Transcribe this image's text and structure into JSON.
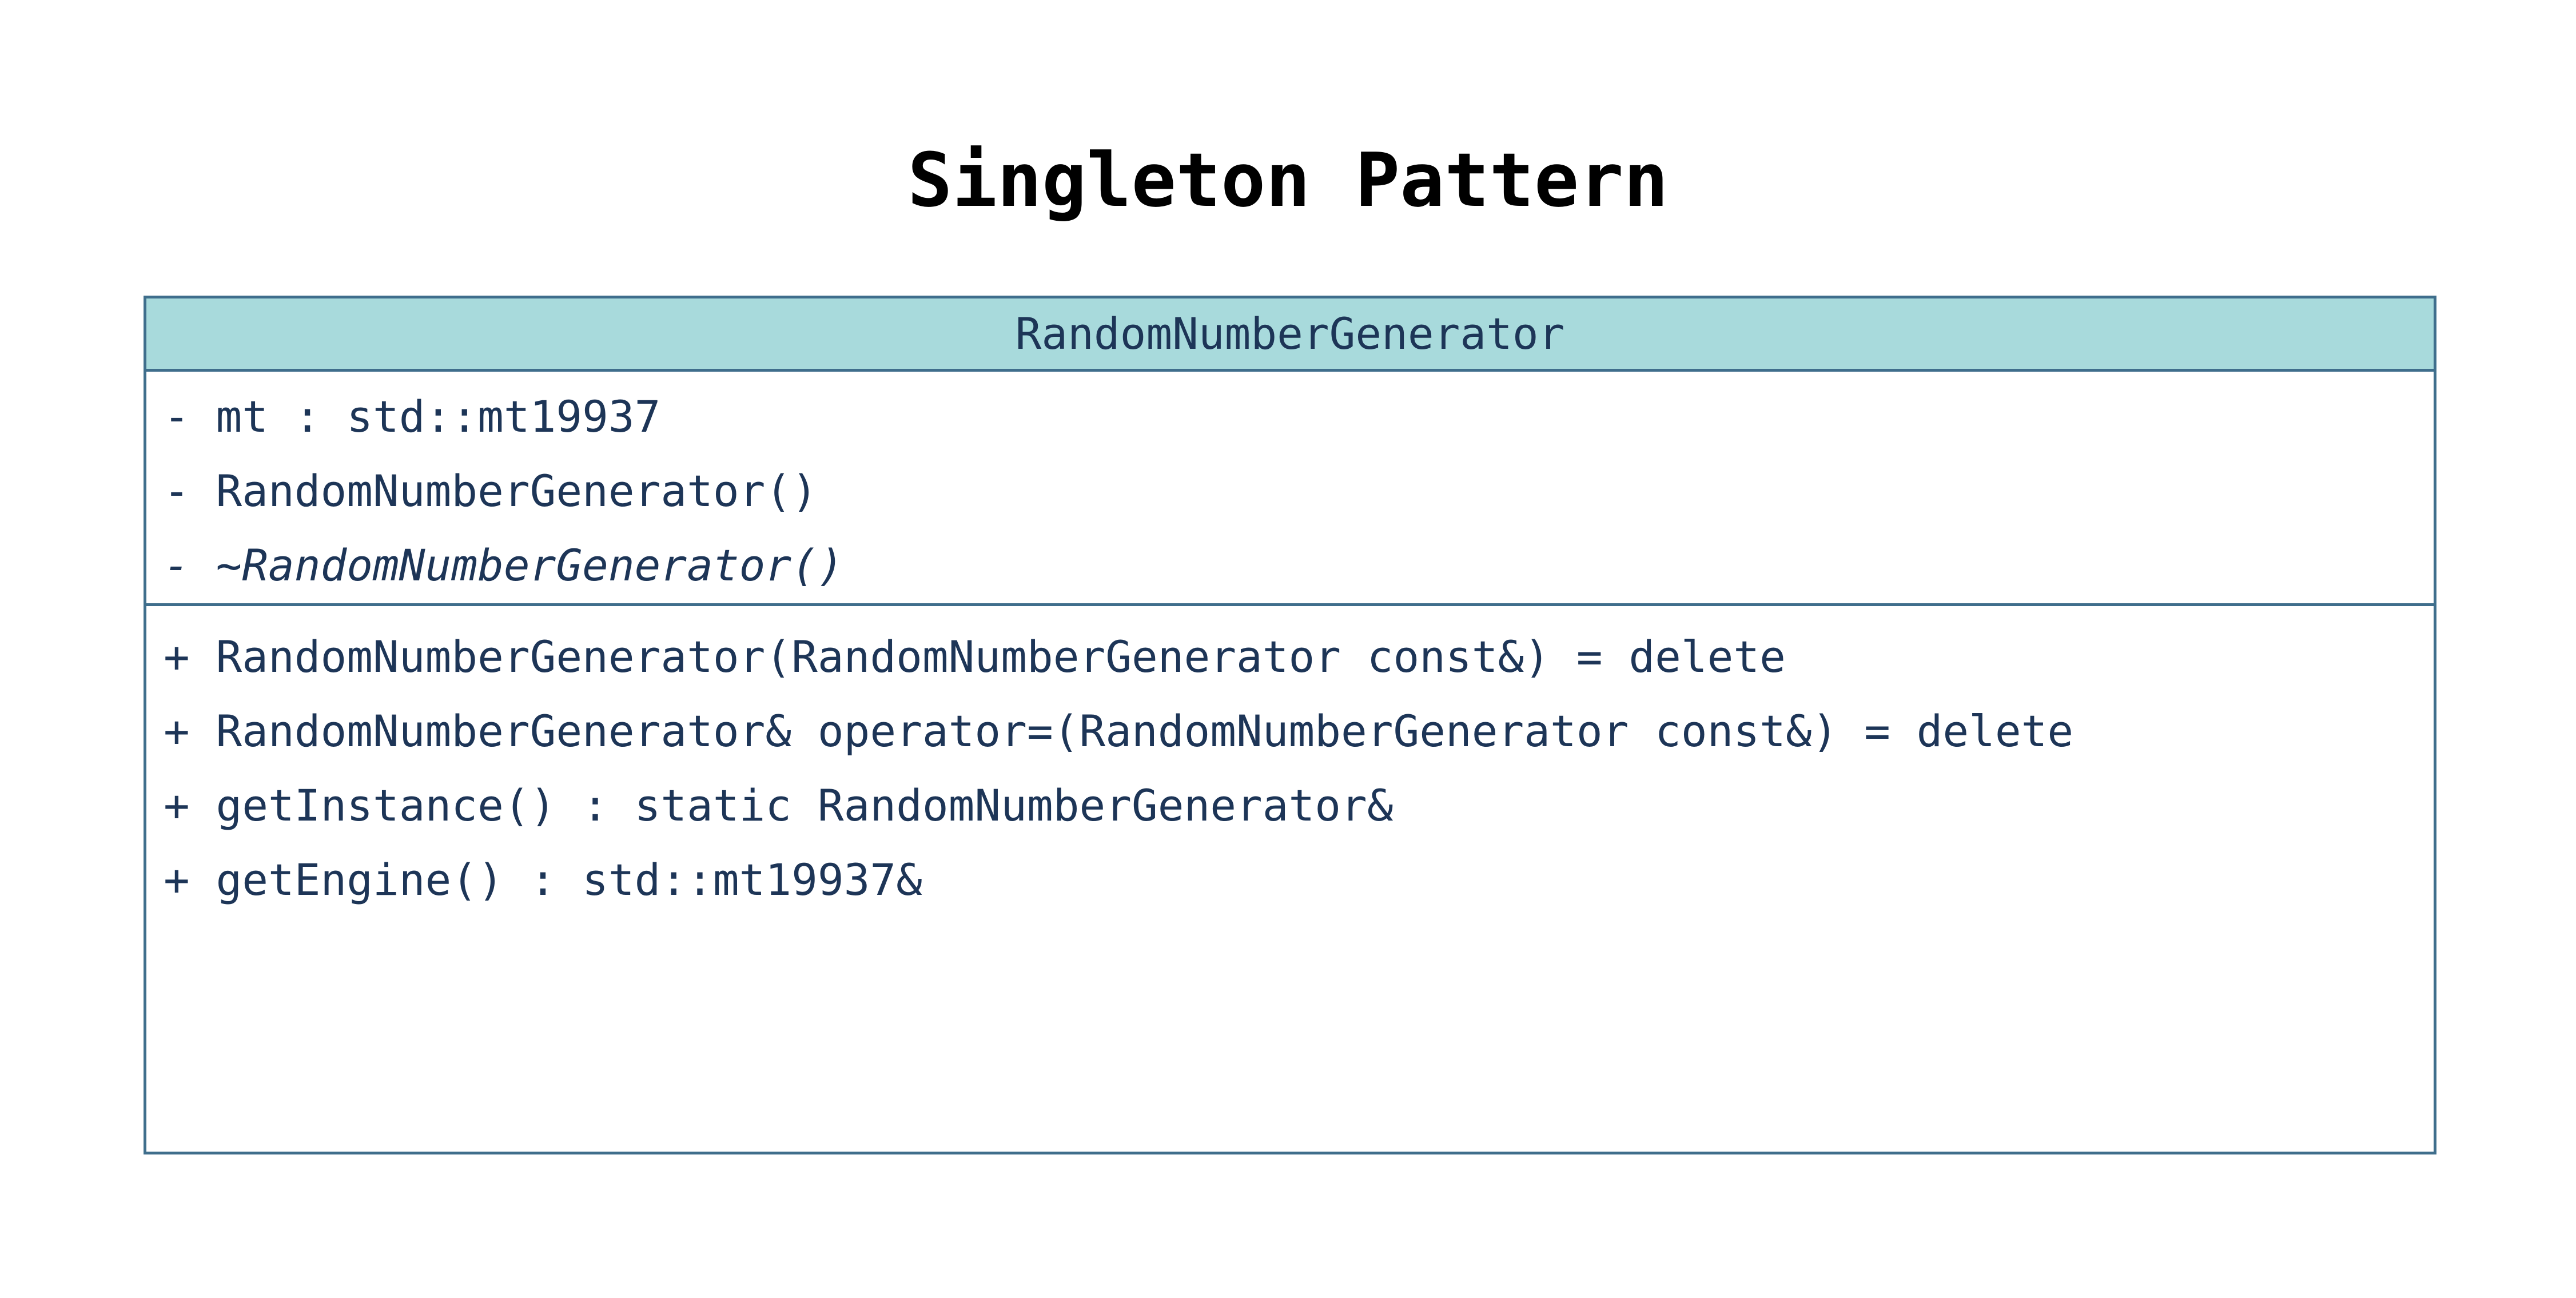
{
  "title": "Singleton Pattern",
  "class": {
    "name": "RandomNumberGenerator",
    "header_color": "#a8dadc",
    "border_color": "#3f6e8c",
    "text_color": "#1d3557",
    "attributes": [
      {
        "text": "- mt : std::mt19937",
        "italic": false
      },
      {
        "text": "- RandomNumberGenerator()",
        "italic": false
      },
      {
        "text": "- ~RandomNumberGenerator()",
        "italic": true
      }
    ],
    "operations": [
      {
        "text": "+ RandomNumberGenerator(RandomNumberGenerator const&) = delete",
        "italic": false
      },
      {
        "text": "+ RandomNumberGenerator& operator=(RandomNumberGenerator const&) = delete",
        "italic": false
      },
      {
        "text": "+ getInstance() : static RandomNumberGenerator&",
        "italic": false
      },
      {
        "text": "+ getEngine() : std::mt19937&",
        "italic": false
      }
    ]
  }
}
